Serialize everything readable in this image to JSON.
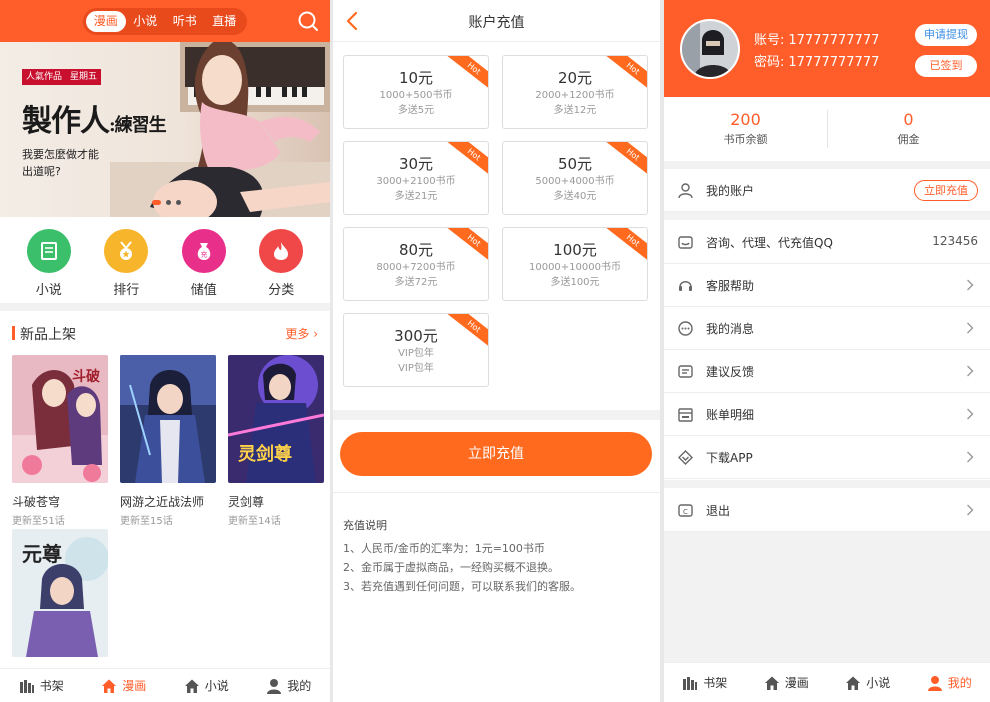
{
  "home": {
    "tabs": [
      "漫画",
      "小说",
      "听书",
      "直播"
    ],
    "banner": {
      "tag1": "人氣作品",
      "tag2": "星期五",
      "title": "製作人",
      "title_suffix": ":練習生",
      "subtitle": "我要怎麼做才能出道呢?"
    },
    "categories": [
      {
        "label": "小说",
        "color": "#3bbf6a",
        "icon": "book-icon"
      },
      {
        "label": "排行",
        "color": "#f7b52c",
        "icon": "medal-icon"
      },
      {
        "label": "储值",
        "color": "#e8308a",
        "icon": "money-bag-icon"
      },
      {
        "label": "分类",
        "color": "#f04848",
        "icon": "flame-icon"
      }
    ],
    "section_title": "新品上架",
    "more": "更多",
    "books": [
      {
        "title": "斗破苍穹",
        "update": "更新至51话"
      },
      {
        "title": "网游之近战法师",
        "update": "更新至15话"
      },
      {
        "title": "灵剑尊",
        "update": "更新至14话"
      },
      {
        "title": "元尊",
        "update": ""
      }
    ],
    "tabbar": [
      {
        "label": "书架",
        "icon": "bookshelf-icon"
      },
      {
        "label": "漫画",
        "icon": "home-icon"
      },
      {
        "label": "小说",
        "icon": "home-icon"
      },
      {
        "label": "我的",
        "icon": "user-icon"
      }
    ]
  },
  "recharge": {
    "title": "账户充值",
    "hot": "Hot",
    "plans": [
      {
        "price": "10元",
        "line1": "1000+500书币",
        "line2": "多送5元"
      },
      {
        "price": "20元",
        "line1": "2000+1200书币",
        "line2": "多送12元"
      },
      {
        "price": "30元",
        "line1": "3000+2100书币",
        "line2": "多送21元"
      },
      {
        "price": "50元",
        "line1": "5000+4000书币",
        "line2": "多送40元"
      },
      {
        "price": "80元",
        "line1": "8000+7200书币",
        "line2": "多送72元"
      },
      {
        "price": "100元",
        "line1": "10000+10000书币",
        "line2": "多送100元"
      },
      {
        "price": "300元",
        "line1": "VIP包年",
        "line2": "VIP包年"
      }
    ],
    "pay_button": "立即充值",
    "notes_title": "充值说明",
    "notes": [
      "1、人民币/金币的汇率为：1元=100书币",
      "2、金币属于虚拟商品，一经购买概不退换。",
      "3、若充值遇到任何问题，可以联系我们的客服。"
    ]
  },
  "profile": {
    "account_label": "账号:",
    "account": "17777777777",
    "password_label": "密码:",
    "password": "17777777777",
    "withdraw_btn": "申请提现",
    "signed_btn": "已签到",
    "balance_value": "200",
    "balance_label": "书币余额",
    "commission_value": "0",
    "commission_label": "佣金",
    "menu": [
      {
        "label": "我的账户",
        "right": "立即充值"
      },
      {
        "label": "咨询、代理、代充值QQ",
        "right": "123456"
      },
      {
        "label": "客服帮助"
      },
      {
        "label": "我的消息"
      },
      {
        "label": "建议反馈"
      },
      {
        "label": "账单明细"
      },
      {
        "label": "下载APP"
      },
      {
        "label": "退出"
      }
    ],
    "tabbar": [
      {
        "label": "书架"
      },
      {
        "label": "漫画"
      },
      {
        "label": "小说"
      },
      {
        "label": "我的"
      }
    ]
  }
}
